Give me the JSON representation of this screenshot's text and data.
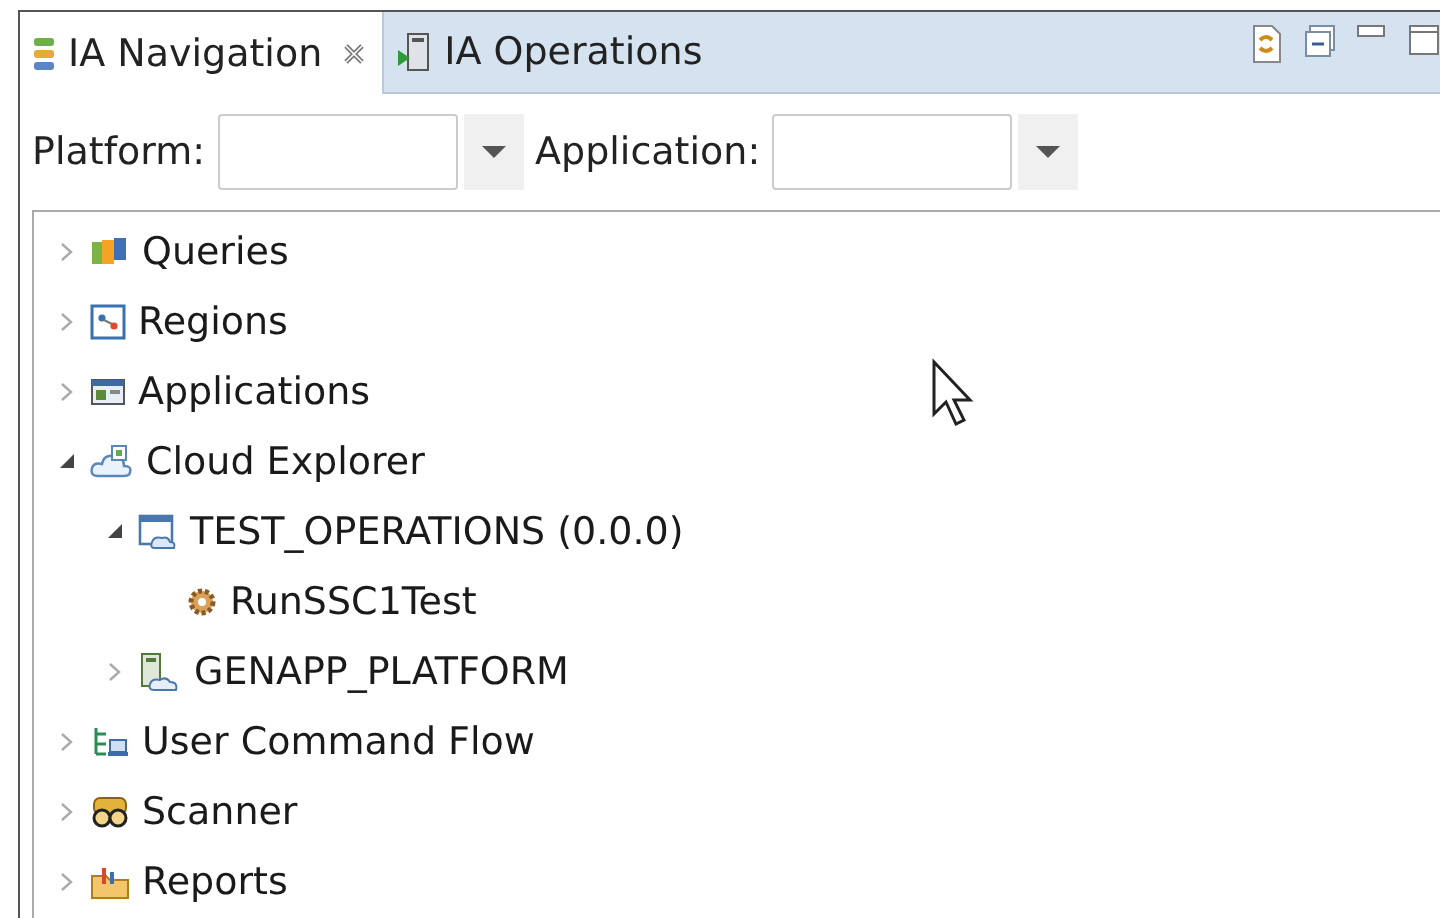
{
  "tabs": [
    {
      "label": "IA Navigation",
      "selected": true,
      "kind": "navigation",
      "closable": true
    },
    {
      "label": "IA Operations",
      "selected": false,
      "kind": "operations",
      "closable": false
    }
  ],
  "filters": [
    {
      "label": "Platform:"
    },
    {
      "label": "Application:"
    }
  ],
  "tree": [
    {
      "label": "Queries",
      "kind": "queries",
      "expanded": false
    },
    {
      "label": "Regions",
      "kind": "regions",
      "expanded": false
    },
    {
      "label": "Applications",
      "kind": "applications",
      "expanded": false
    },
    {
      "label": "Cloud Explorer",
      "kind": "cloud",
      "expanded": true,
      "children": [
        {
          "label": "TEST_OPERATIONS (0.0.0)",
          "kind": "window",
          "expanded": true,
          "children": [
            {
              "label": "RunSSC1Test",
              "kind": "gear"
            }
          ]
        },
        {
          "label": "GENAPP_PLATFORM",
          "kind": "server",
          "expanded": false
        }
      ]
    },
    {
      "label": "User Command Flow",
      "kind": "flow",
      "expanded": false
    },
    {
      "label": "Scanner",
      "kind": "scanner",
      "expanded": false
    },
    {
      "label": "Reports",
      "kind": "reports",
      "expanded": false
    }
  ]
}
